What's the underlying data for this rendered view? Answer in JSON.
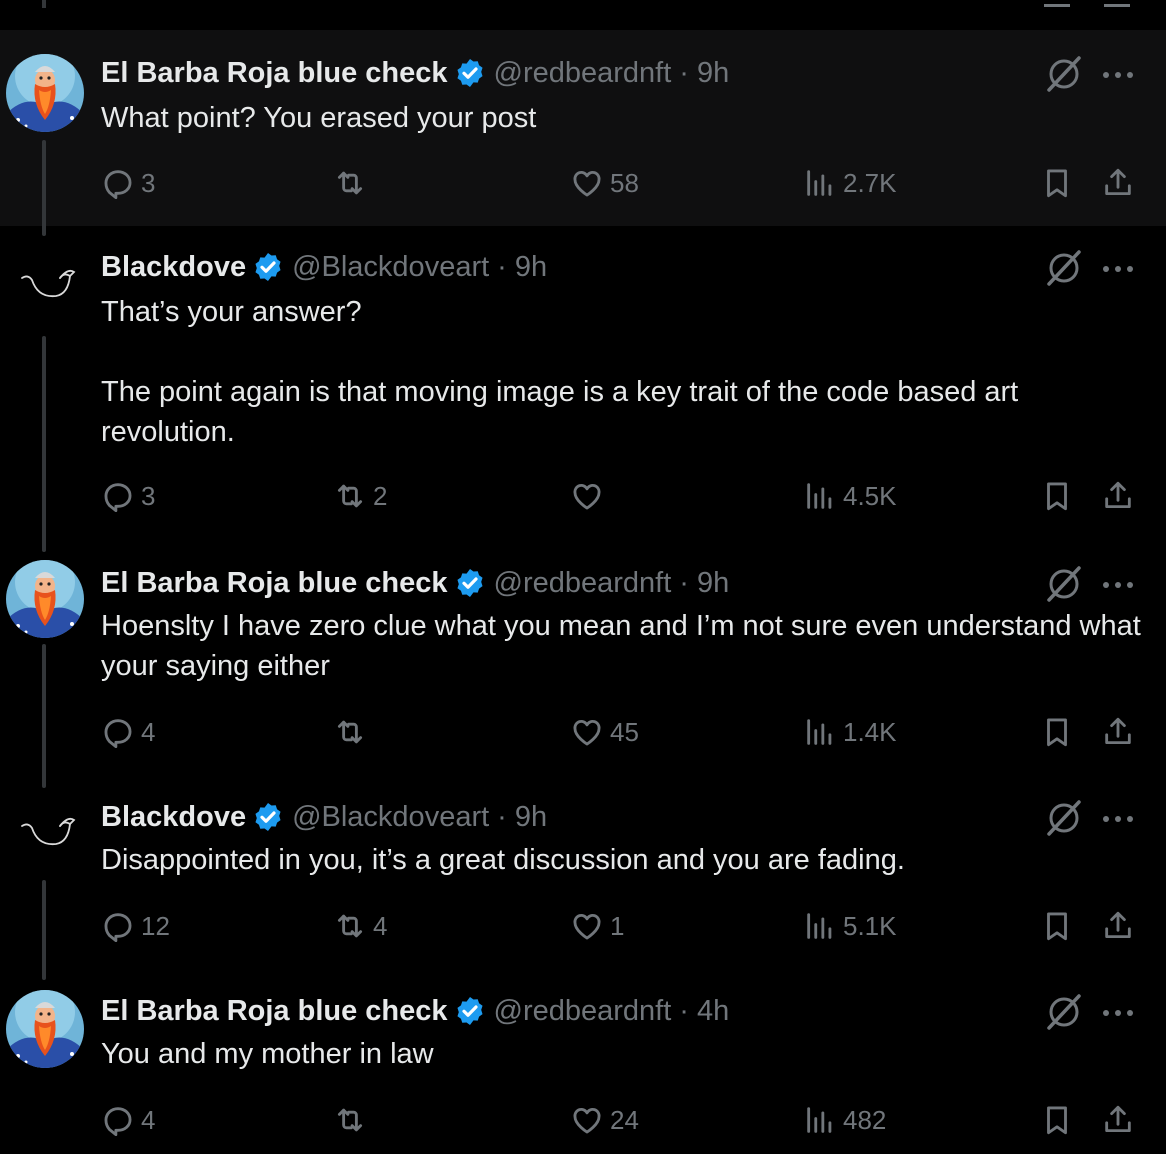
{
  "tweets": [
    {
      "name": "El Barba Roja blue check",
      "handle": "@redbeardnft",
      "time": "9h",
      "paragraphs": [
        "What point? You erased your post"
      ],
      "replies": "3",
      "reposts": "",
      "likes": "58",
      "views": "2.7K",
      "avatar": "redbeard"
    },
    {
      "name": "Blackdove",
      "handle": "@Blackdoveart",
      "time": "9h",
      "paragraphs": [
        "That’s your answer?",
        "The point again is that moving image is a key trait of the code based art revolution."
      ],
      "replies": "3",
      "reposts": "2",
      "likes": "",
      "views": "4.5K",
      "avatar": "dove"
    },
    {
      "name": "El Barba Roja blue check",
      "handle": "@redbeardnft",
      "time": "9h",
      "paragraphs": [
        "Hoenslty I have zero clue what you mean and I’m not sure even understand what your saying either"
      ],
      "replies": "4",
      "reposts": "",
      "likes": "45",
      "views": "1.4K",
      "avatar": "redbeard"
    },
    {
      "name": "Blackdove",
      "handle": "@Blackdoveart",
      "time": "9h",
      "paragraphs": [
        "Disappointed in you, it’s a great discussion and you are fading."
      ],
      "replies": "12",
      "reposts": "4",
      "likes": "1",
      "views": "5.1K",
      "avatar": "dove"
    },
    {
      "name": "El Barba Roja blue check",
      "handle": "@redbeardnft",
      "time": "4h",
      "paragraphs": [
        "You and my mother in law"
      ],
      "replies": "4",
      "reposts": "",
      "likes": "24",
      "views": "482",
      "avatar": "redbeard"
    }
  ],
  "icons": {
    "reply": "reply-icon",
    "repost": "repost-icon",
    "like": "like-icon",
    "views": "views-icon",
    "bookmark": "bookmark-icon",
    "share": "share-icon",
    "verified": "verified-badge-icon",
    "grok": "grok-icon",
    "more": "more-icon"
  },
  "colors": {
    "background": "#000000",
    "highlight": "#0f0f10",
    "text": "#e7e9ea",
    "muted": "#71767b",
    "verified": "#1d9bf0"
  }
}
